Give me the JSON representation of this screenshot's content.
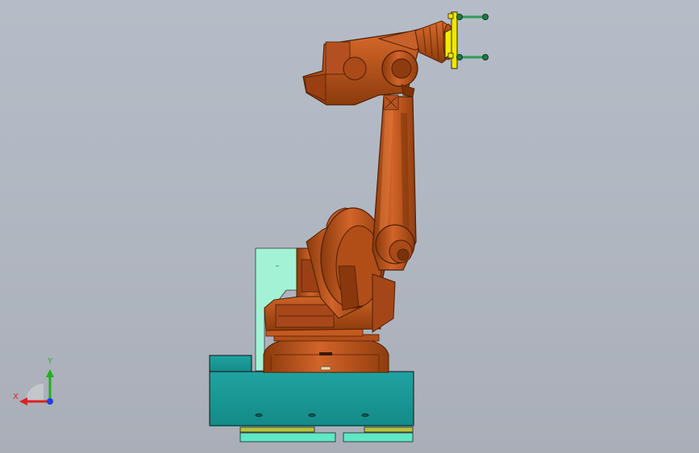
{
  "viewport": {
    "background_top": "#b6bcc7",
    "background_bottom": "#a9aeb7"
  },
  "model": {
    "robot_color": "#c75a1c",
    "robot_shadow": "#7a3309",
    "robot_highlight": "#e2782e",
    "pedestal_color": "#1a9a98",
    "mint_panel_color": "#9ff0d4",
    "gripper_color": "#f2e600",
    "gripper_pins_color": "#2fa05a"
  },
  "triad": {
    "x_label": "X",
    "y_label": "Y",
    "x_color": "#e02020",
    "y_color": "#20b020",
    "z_color": "#2040e0",
    "icons": [
      "x-axis-arrow-icon",
      "y-axis-arrow-icon",
      "z-axis-dot-icon"
    ]
  }
}
